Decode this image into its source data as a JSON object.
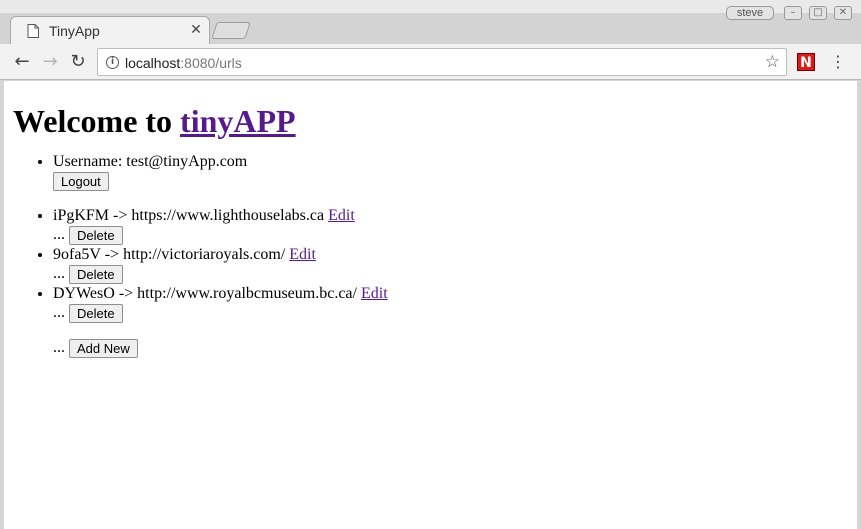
{
  "browser": {
    "tab_title": "TinyApp",
    "tab_close": "✕",
    "user_badge": "steve",
    "url_host": "localhost",
    "url_rest": ":8080/urls",
    "extension_label": "N",
    "menu_glyph": "⋮",
    "star_glyph": "☆",
    "back_glyph": "←",
    "forward_glyph": "→",
    "reload_glyph": "↻",
    "info_glyph": "i"
  },
  "page": {
    "heading_prefix": "Welcome to ",
    "heading_link": "tinyAPP",
    "username_text": "Username: test@tinyApp.com",
    "logout_label": "Logout",
    "urls": [
      {
        "short": "iPgKFM",
        "arrow": "->",
        "long": "https://www.lighthouselabs.ca",
        "edit": "Edit",
        "ellipsis": "...",
        "delete": "Delete"
      },
      {
        "short": "9ofa5V",
        "arrow": "->",
        "long": "http://victoriaroyals.com/",
        "edit": "Edit",
        "ellipsis": "...",
        "delete": "Delete"
      },
      {
        "short": "DYWesO",
        "arrow": "->",
        "long": "http://www.royalbcmuseum.bc.ca/",
        "edit": "Edit",
        "ellipsis": "...",
        "delete": "Delete"
      }
    ],
    "add_ellipsis": "...",
    "add_label": "Add New"
  },
  "colors": {
    "link_visited": "#551a8b",
    "extension_red": "#d41f1f"
  }
}
